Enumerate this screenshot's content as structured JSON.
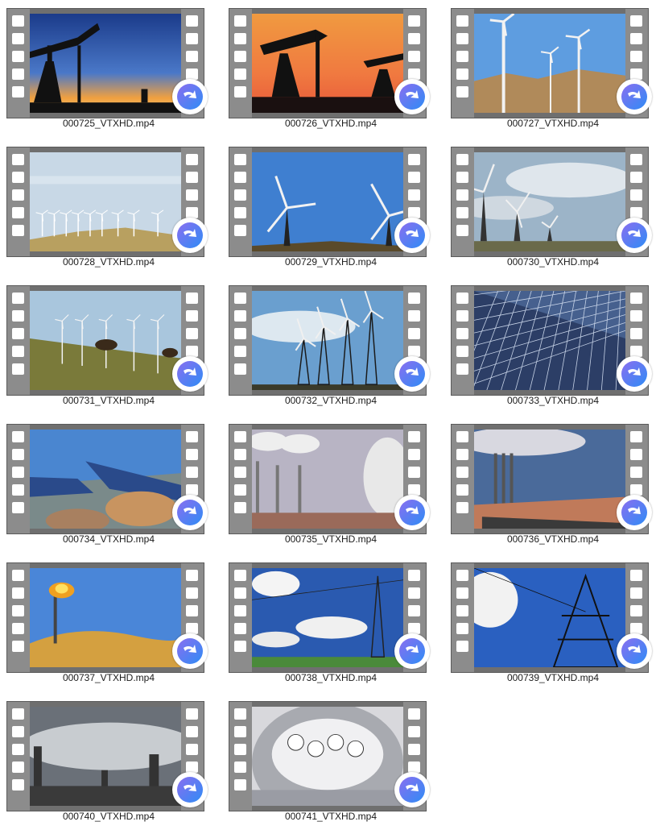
{
  "files": [
    {
      "name": "000725_VTXHD.mp4",
      "icon": "oil-pump-sunset-thumbnail"
    },
    {
      "name": "000726_VTXHD.mp4",
      "icon": "oil-pumps-orange-sky-thumbnail"
    },
    {
      "name": "000727_VTXHD.mp4",
      "icon": "wind-turbines-desert-thumbnail"
    },
    {
      "name": "000728_VTXHD.mp4",
      "icon": "wind-farm-hills-thumbnail"
    },
    {
      "name": "000729_VTXHD.mp4",
      "icon": "wind-turbines-blue-sky-thumbnail"
    },
    {
      "name": "000730_VTXHD.mp4",
      "icon": "wind-turbines-cloudy-thumbnail"
    },
    {
      "name": "000731_VTXHD.mp4",
      "icon": "cows-wind-turbines-thumbnail"
    },
    {
      "name": "000732_VTXHD.mp4",
      "icon": "lattice-wind-turbines-thumbnail"
    },
    {
      "name": "000733_VTXHD.mp4",
      "icon": "solar-panel-closeup-thumbnail"
    },
    {
      "name": "000734_VTXHD.mp4",
      "icon": "solar-array-rocks-thumbnail"
    },
    {
      "name": "000735_VTXHD.mp4",
      "icon": "power-plant-smokestacks-thumbnail"
    },
    {
      "name": "000736_VTXHD.mp4",
      "icon": "power-plant-road-thumbnail"
    },
    {
      "name": "000737_VTXHD.mp4",
      "icon": "gas-flare-desert-thumbnail"
    },
    {
      "name": "000738_VTXHD.mp4",
      "icon": "power-lines-clouds-thumbnail"
    },
    {
      "name": "000739_VTXHD.mp4",
      "icon": "transmission-tower-sky-thumbnail"
    },
    {
      "name": "000740_VTXHD.mp4",
      "icon": "industrial-plant-smoke-thumbnail"
    },
    {
      "name": "000741_VTXHD.mp4",
      "icon": "electric-meter-thumbnail"
    }
  ],
  "overlay_icon": "video-player-arrow-icon",
  "colors": {
    "background": "#ffffff",
    "filmstrip": "#8c8c8c",
    "badge_accent": "#3d8bff"
  }
}
